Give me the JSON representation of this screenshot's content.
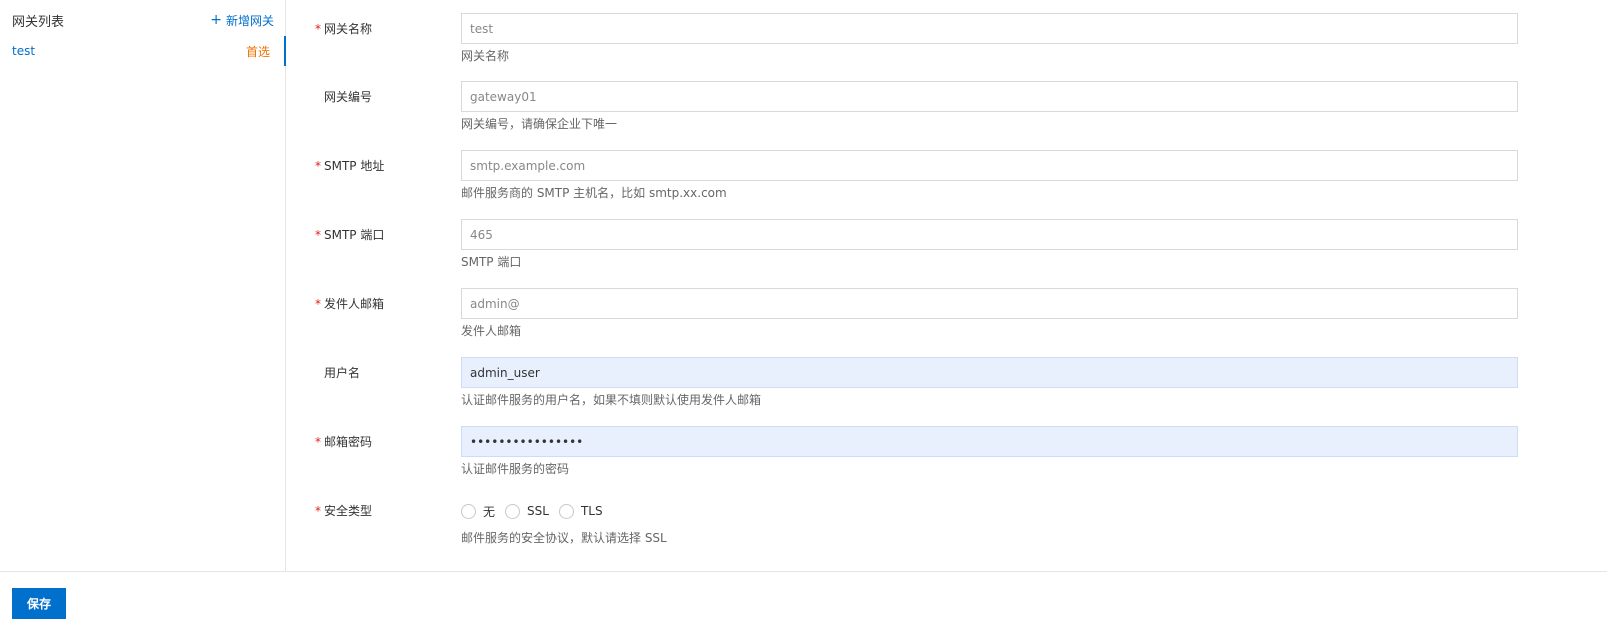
{
  "sidebar": {
    "title": "网关列表",
    "add_label": "新增网关",
    "items": [
      {
        "name": "test",
        "badge": "首选"
      }
    ]
  },
  "form": {
    "gateway_name": {
      "label": "网关名称",
      "required": true,
      "value": "test",
      "help": "网关名称"
    },
    "gateway_id": {
      "label": "网关编号",
      "required": false,
      "value": "gateway01",
      "help": "网关编号，请确保企业下唯一"
    },
    "smtp_host": {
      "label": "SMTP 地址",
      "required": true,
      "value": "smtp.example.com",
      "help": "邮件服务商的 SMTP 主机名，比如 smtp.xx.com"
    },
    "smtp_port": {
      "label": "SMTP 端口",
      "required": true,
      "value": "465",
      "help": "SMTP 端口"
    },
    "sender_email": {
      "label": "发件人邮箱",
      "required": true,
      "value": "admin@",
      "help": "发件人邮箱"
    },
    "username": {
      "label": "用户名",
      "required": false,
      "value": "admin_user",
      "help": "认证邮件服务的用户名，如果不填则默认使用发件人邮箱"
    },
    "password": {
      "label": "邮箱密码",
      "required": true,
      "value": "••••••••••••••••",
      "help": "认证邮件服务的密码"
    },
    "security_type": {
      "label": "安全类型",
      "required": true,
      "options": [
        "无",
        "SSL",
        "TLS"
      ],
      "help": "邮件服务的安全协议，默认请选择 SSL"
    }
  },
  "footer": {
    "save_label": "保存"
  },
  "colors": {
    "accent": "#0070cc",
    "badge": "#f07000",
    "required": "#e02020",
    "autofill": "#e8f0fe"
  }
}
